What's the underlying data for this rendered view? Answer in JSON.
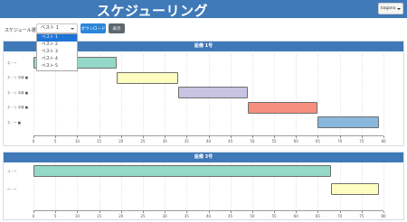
{
  "header": {
    "title": "スケジューリング",
    "user": "nagano"
  },
  "toolbar": {
    "label": "スケジュール選択",
    "selected": "ベスト 1",
    "options": [
      "ベスト 1",
      "ベスト 2",
      "ベスト 3",
      "ベスト 4",
      "ベスト 5"
    ],
    "download_label": "ダウンロード",
    "display_label": "表示"
  },
  "chart_data": [
    {
      "type": "gantt",
      "title": "設備 1号",
      "xlim": [
        0,
        80
      ],
      "ticks": [
        0,
        5,
        10,
        15,
        20,
        25,
        30,
        35,
        40,
        45,
        50,
        55,
        60,
        65,
        70,
        75,
        80
      ],
      "rows": [
        "ネ・ー",
        "ネ・リ 半導 ■",
        "ネ・リ 半導 ■",
        "ネ・リ 半導 ■",
        "ネ・ー ■"
      ],
      "tasks": [
        {
          "row": 0,
          "start": 0,
          "end": 19,
          "color": "#94d9c8"
        },
        {
          "row": 1,
          "start": 19,
          "end": 33,
          "color": "#fdfdbf"
        },
        {
          "row": 2,
          "start": 33,
          "end": 49,
          "color": "#c8c4e2"
        },
        {
          "row": 3,
          "start": 49,
          "end": 65,
          "color": "#f78f7f"
        },
        {
          "row": 4,
          "start": 65,
          "end": 79,
          "color": "#8ab7dc"
        }
      ]
    },
    {
      "type": "gantt",
      "title": "設備 3号",
      "xlim": [
        0,
        80
      ],
      "ticks": [
        0,
        5,
        10,
        15,
        20,
        25,
        30,
        35,
        40,
        45,
        50,
        55,
        60,
        65,
        70,
        75,
        80
      ],
      "rows": [
        "ユ・ー",
        "ヘ・ー"
      ],
      "tasks": [
        {
          "row": 0,
          "start": 0,
          "end": 68,
          "color": "#94d9c8"
        },
        {
          "row": 1,
          "start": 68,
          "end": 79,
          "color": "#fdfdbf"
        }
      ]
    }
  ]
}
